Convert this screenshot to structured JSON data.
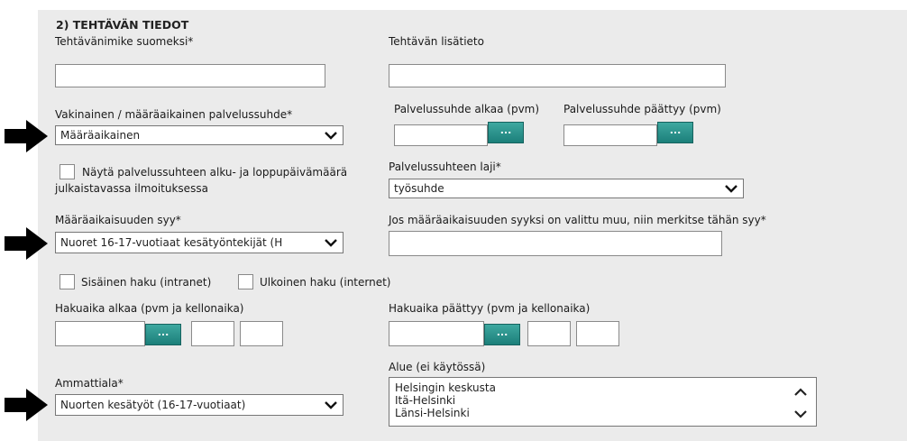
{
  "section": {
    "title": "2) TEHTÄVÄN TIEDOT"
  },
  "labels": {
    "task_title_fi": "Tehtävänimike suomeksi*",
    "task_extra": "Tehtävän lisätieto",
    "permanent_temporary": "Vakinainen / määräaikainen palvelussuhde*",
    "service_start": "Palvelussuhde alkaa (pvm)",
    "service_end": "Palvelussuhde päättyy (pvm)",
    "show_dates_line1": "Näytä palvelussuhteen alku- ja loppupäivämäärä",
    "show_dates_line2": "julkaistavassa ilmoituksessa",
    "service_type": "Palvelussuhteen laji*",
    "temp_reason": "Määräaikaisuuden syy*",
    "other_reason": "Jos määräaikaisuuden syyksi on valittu muu, niin merkitse tähän syy*",
    "internal_search": "Sisäinen haku (intranet)",
    "external_search": "Ulkoinen haku (internet)",
    "apply_start": "Hakuaika alkaa (pvm ja kellonaika)",
    "apply_end": "Hakuaika päättyy (pvm ja kellonaika)",
    "profession": "Ammattiala*",
    "area": "Alue (ei käytössä)"
  },
  "selects": {
    "permanent_temporary": "Määräaikainen",
    "service_type": "työsuhde",
    "temp_reason": "Nuoret 16-17-vuotiaat kesätyöntekijät (H",
    "profession": "Nuorten kesätyöt (16-17-vuotiaat)"
  },
  "calendar_button": "...",
  "area_options": [
    "Helsingin keskusta",
    "Itä-Helsinki",
    "Länsi-Helsinki"
  ],
  "colors": {
    "panel": "#ebebeb",
    "calendar_button": "#2a8f8a"
  }
}
